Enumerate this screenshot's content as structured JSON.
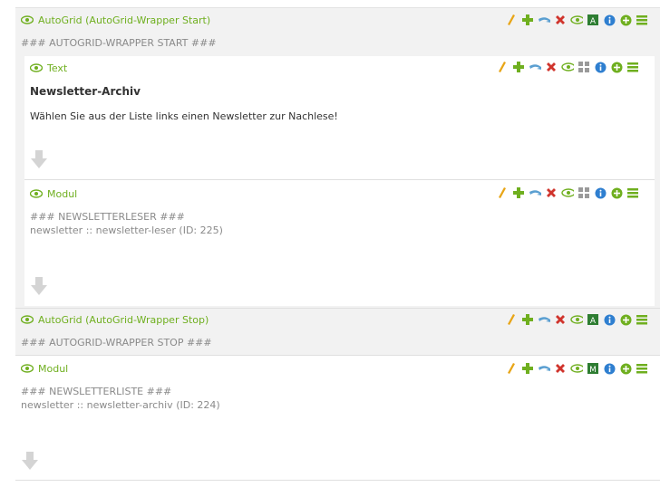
{
  "blocks": [
    {
      "title": "AutoGrid (AutoGrid-Wrapper Start)",
      "code": "### AUTOGRID-WRAPPER START ###"
    },
    {
      "title": "Text",
      "headline": "Newsletter-Archiv",
      "text": "Wählen Sie aus der Liste links einen Newsletter zur Nachlese!"
    },
    {
      "title": "Modul",
      "code_line1": "### NEWSLETTERLESER ###",
      "code_line2": "newsletter :: newsletter-leser (ID: 225)"
    },
    {
      "title": "AutoGrid (AutoGrid-Wrapper Stop)",
      "code": "### AUTOGRID-WRAPPER STOP ###"
    },
    {
      "title": "Modul",
      "code_line1": "### NEWSLETTERLISTE ###",
      "code_line2": "newsletter :: newsletter-archiv (ID: 224)"
    }
  ],
  "icons": [
    "eye-icon",
    "edit-icon",
    "add-icon",
    "move-icon",
    "delete-icon",
    "visibility-toggle-icon",
    "grid-icon",
    "info-icon",
    "add-below-icon",
    "menu-icon",
    "drag-down-icon"
  ],
  "colors": {
    "accent_green": "#6faf1f",
    "gray_text": "#8a8a8a",
    "panel_gray": "#f2f2f2",
    "info_blue": "#2f7fd0",
    "delete_red": "#d0342c",
    "edit_orange": "#e8a516"
  }
}
